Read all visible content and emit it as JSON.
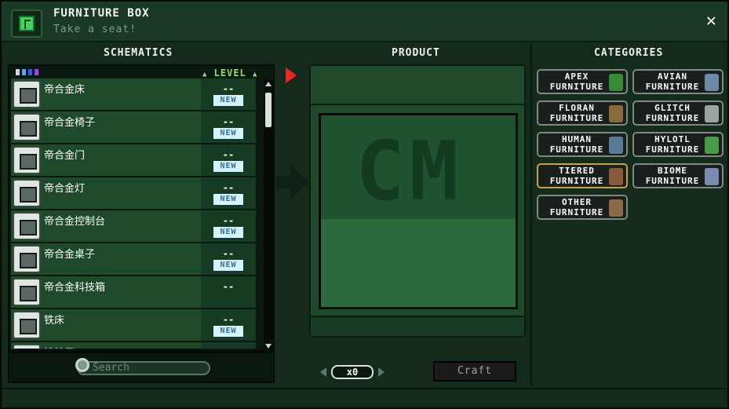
{
  "window": {
    "title": "FURNITURE BOX",
    "subtitle": "Take a seat!",
    "close_symbol": "✕"
  },
  "columns": {
    "schematics": "SCHEMATICS",
    "product": "PRODUCT",
    "categories": "CATEGORIES"
  },
  "schematics": {
    "level_header": "LEVEL",
    "color_filters": [
      "#c8d8e8",
      "#6aa0e0",
      "#3a5ad8",
      "#9a4ad0"
    ],
    "items": [
      {
        "name": "帝合金床",
        "level": "--",
        "badge": "NEW",
        "icon": "bed-icon"
      },
      {
        "name": "帝合金椅子",
        "level": "--",
        "badge": "NEW",
        "icon": "chair-icon"
      },
      {
        "name": "帝合金门",
        "level": "--",
        "badge": "NEW",
        "icon": "door-icon"
      },
      {
        "name": "帝合金灯",
        "level": "--",
        "badge": "NEW",
        "icon": "lamp-icon"
      },
      {
        "name": "帝合金控制台",
        "level": "--",
        "badge": "NEW",
        "icon": "console-icon"
      },
      {
        "name": "帝合金桌子",
        "level": "--",
        "badge": "NEW",
        "icon": "table-icon"
      },
      {
        "name": "帝合金科技箱",
        "level": "--",
        "badge": "",
        "icon": "tech-box-icon"
      },
      {
        "name": "铁床",
        "level": "--",
        "badge": "NEW",
        "icon": "bed-icon"
      },
      {
        "name": "铁椅子",
        "level": "",
        "badge": "",
        "icon": "chair-icon"
      }
    ]
  },
  "search": {
    "placeholder": "Search"
  },
  "product": {
    "placeholder_text": "CM"
  },
  "quantity": {
    "value": "x0"
  },
  "craft": {
    "label": "Craft"
  },
  "categories": [
    {
      "line1": "APEX",
      "line2": "FURNITURE",
      "icon": "apex-icon",
      "color": "#3a8a3a",
      "active": false
    },
    {
      "line1": "AVIAN",
      "line2": "FURNITURE",
      "icon": "avian-icon",
      "color": "#6a8aa8",
      "active": false
    },
    {
      "line1": "FLORAN",
      "line2": "FURNITURE",
      "icon": "floran-icon",
      "color": "#8a6a3a",
      "active": false
    },
    {
      "line1": "GLITCH",
      "line2": "FURNITURE",
      "icon": "glitch-icon",
      "color": "#9aa4a0",
      "active": false
    },
    {
      "line1": "HUMAN",
      "line2": "FURNITURE",
      "icon": "human-icon",
      "color": "#5a7a9a",
      "active": false
    },
    {
      "line1": "HYLOTL",
      "line2": "FURNITURE",
      "icon": "hylotl-icon",
      "color": "#4a9a4a",
      "active": false
    },
    {
      "line1": "TIERED",
      "line2": "FURNITURE",
      "icon": "tiered-icon",
      "color": "#8a5a3a",
      "active": true
    },
    {
      "line1": "BIOME",
      "line2": "FURNITURE",
      "icon": "biome-icon",
      "color": "#7a8ab0",
      "active": false
    },
    {
      "line1": "OTHER",
      "line2": "FURNITURE",
      "icon": "other-icon",
      "color": "#8a6a4a",
      "active": false
    }
  ]
}
